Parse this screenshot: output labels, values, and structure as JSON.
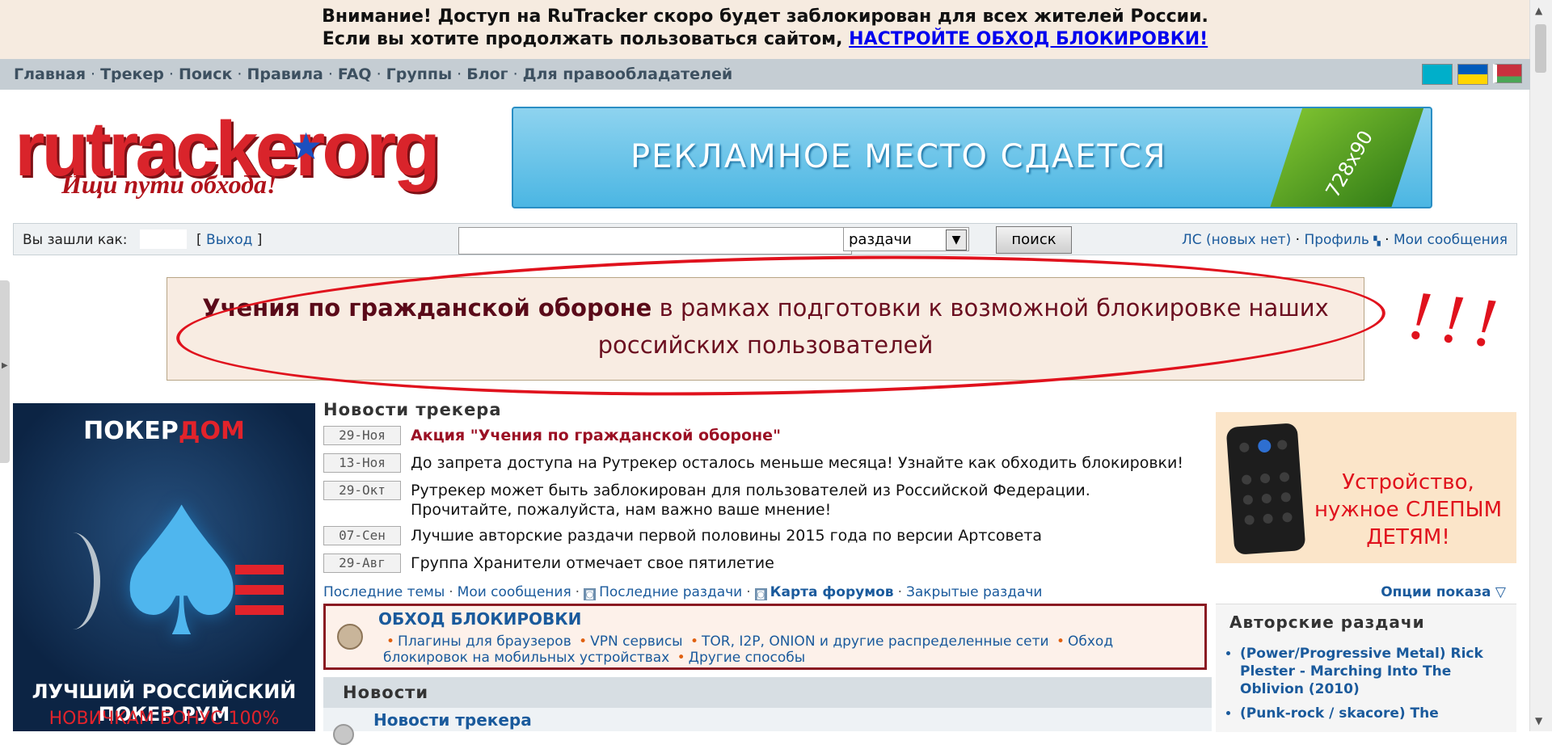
{
  "warning": {
    "line1": "Внимание! Доступ на RuTracker скоро будет заблокирован для всех жителей России.",
    "line2": "Если вы хотите продолжать пользоваться сайтом,",
    "link": "НАСТРОЙТЕ ОБХОД БЛОКИРОВКИ!"
  },
  "nav": {
    "items": [
      "Главная",
      "Трекер",
      "Поиск",
      "Правила",
      "FAQ",
      "Группы",
      "Блог",
      "Для правообладателей"
    ],
    "separator": "·"
  },
  "logo": {
    "word": "rutracker",
    "org": "org",
    "slogan": "Ищи пути обхода!"
  },
  "banner": {
    "text": "РЕКЛАМНОЕ   МЕСТО   СДАЕТСЯ",
    "size": "728x90"
  },
  "login": {
    "label": "Вы зашли как:",
    "exit": "Выход",
    "search_value": "",
    "select_value": "раздачи",
    "search_button": "поиск",
    "pm": "ЛС (новых нет)",
    "profile": "Профиль",
    "my_messages": "Мои сообщения"
  },
  "notice": {
    "bold": "Учения по гражданской обороне",
    "rest": " в рамках подготовки к возможной блокировке наших российских пользователей",
    "bangs": "!!!"
  },
  "poker": {
    "top_a": "ПОКЕР",
    "top_b": "ДОМ",
    "bottom1": "ЛУЧШИЙ РОССИЙСКИЙ ПОКЕР РУМ",
    "bottom2": "НОВИЧКАМ БОНУС 100%"
  },
  "news": {
    "title": "Новости трекера",
    "items": [
      {
        "date": "29-Ноя",
        "text": "Акция \"Учения по гражданской обороне\""
      },
      {
        "date": "13-Ноя",
        "text": "До запрета доступа на Рутрекер осталось меньше месяца! Узнайте как обходить блокировки!"
      },
      {
        "date": "29-Окт",
        "text": "Рутрекер может быть заблокирован для пользователей из Российской Федерации. Прочитайте, пожалуйста, нам важно ваше мнение!"
      },
      {
        "date": "07-Сен",
        "text": "Лучшие авторские раздачи первой половины 2015 года по версии Артсовета"
      },
      {
        "date": "29-Авг",
        "text": "Группа Хранители отмечает свое пятилетие"
      }
    ]
  },
  "quick": {
    "last_topics": "Последние темы",
    "my_messages": "Мои сообщения",
    "last_releases": "Последние раздачи",
    "forum_map": "Карта форумов",
    "closed": "Закрытые раздачи",
    "options": "Опции показа"
  },
  "device": {
    "text": "Устройство, нужное СЛЕПЫМ ДЕТЯМ!"
  },
  "block": {
    "title": "ОБХОД БЛОКИРОВКИ",
    "links": [
      "Плагины для браузеров",
      "VPN сервисы",
      "TOR, I2P, ONION и другие распределенные сети",
      "Обход блокировок на мобильных устройствах",
      "Другие способы"
    ]
  },
  "section": {
    "title": "Новости",
    "sub": "Новости трекера"
  },
  "author": {
    "title": "Авторские раздачи",
    "items": [
      "(Power/Progressive Metal) Rick Plester - Marching Into The Oblivion (2010)",
      "(Punk-rock / skacore) The"
    ]
  }
}
